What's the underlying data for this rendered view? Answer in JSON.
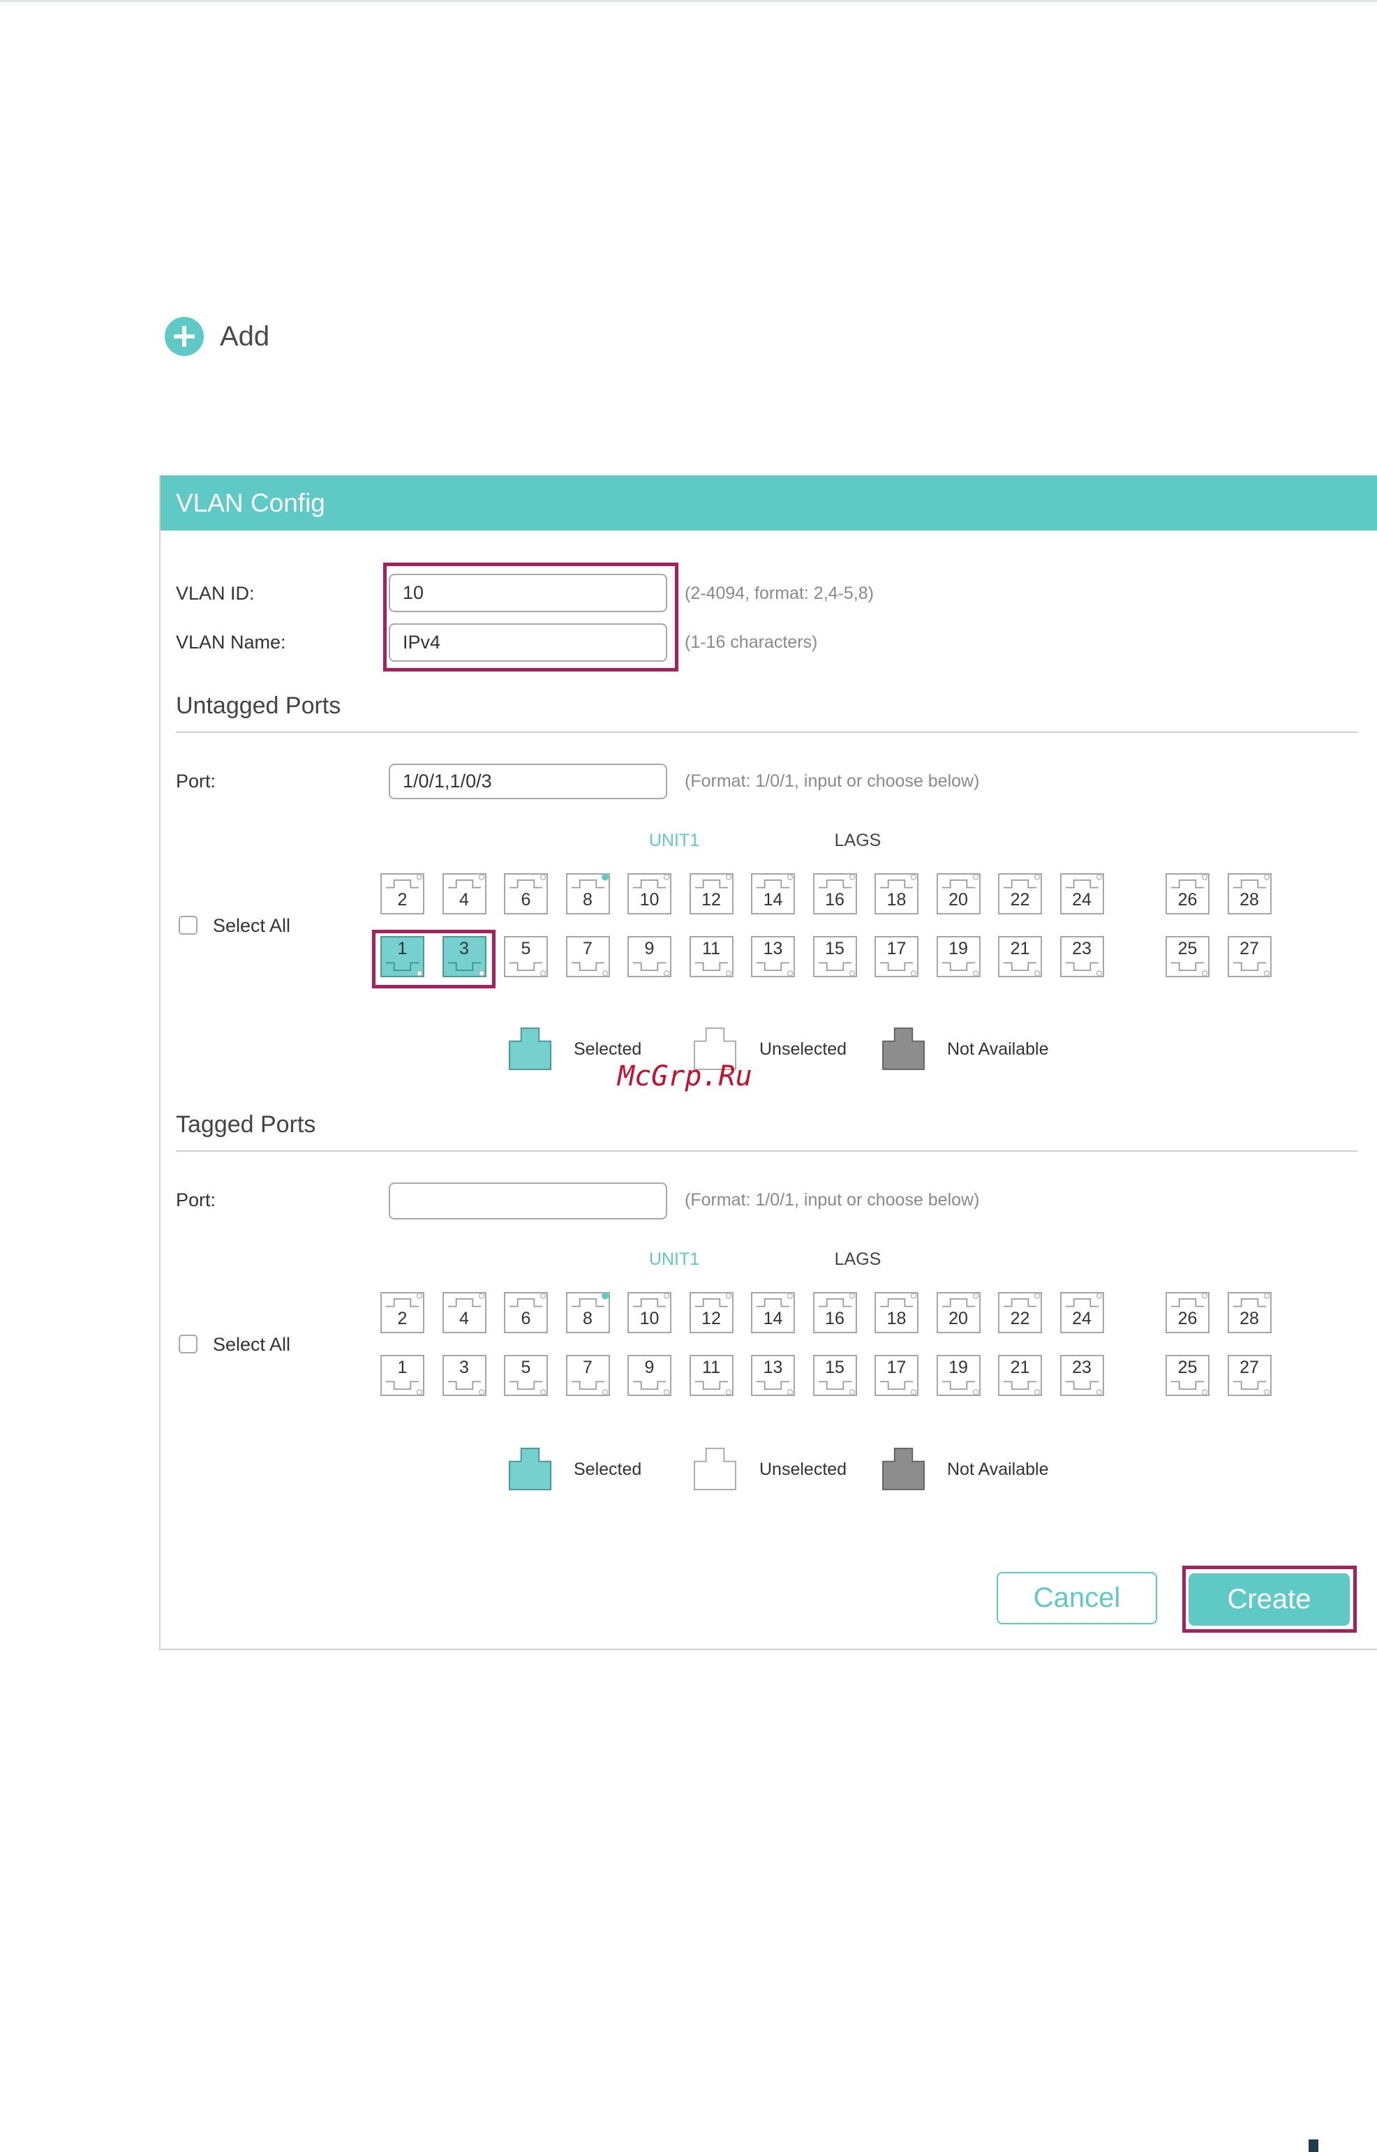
{
  "colors": {
    "accent": "#5fc9c6",
    "highlight": "#a6215e",
    "selected_port": "#76d1ce",
    "selected_port_stroke": "#3f8f8d",
    "not_available": "#8d8d8d",
    "watermark": "#c8102e"
  },
  "toolbar": {
    "add_label": "Add",
    "add_icon": "plus-circle-icon"
  },
  "panel": {
    "title": "VLAN Config",
    "vlan_id": {
      "label": "VLAN ID:",
      "value": "10",
      "hint": "(2-4094, format: 2,4-5,8)"
    },
    "vlan_name": {
      "label": "VLAN Name:",
      "value": "IPv4",
      "hint": "(1-16 characters)"
    },
    "untagged": {
      "heading": "Untagged Ports",
      "port_label": "Port:",
      "port_value": "1/0/1,1/0/3",
      "port_hint": "(Format: 1/0/1, input or choose below)",
      "unit_label": "UNIT1",
      "lags_label": "LAGS",
      "select_all_label": "Select All",
      "select_all_checked": false,
      "unit_ports_top": [
        "2",
        "4",
        "6",
        "8",
        "10",
        "12",
        "14",
        "16",
        "18",
        "20",
        "22",
        "24"
      ],
      "unit_ports_bottom": [
        "1",
        "3",
        "5",
        "7",
        "9",
        "11",
        "13",
        "15",
        "17",
        "19",
        "21",
        "23"
      ],
      "lag_ports_top": [
        "26",
        "28"
      ],
      "lag_ports_bottom": [
        "25",
        "27"
      ],
      "selected_ports": [
        "1",
        "3"
      ],
      "link_up_ports": [
        "8"
      ]
    },
    "tagged": {
      "heading": "Tagged Ports",
      "port_label": "Port:",
      "port_hint": "(Format: 1/0/1, input or choose below)",
      "unit_label": "UNIT1",
      "lags_label": "LAGS",
      "select_all_label": "Select All",
      "select_all_checked": false,
      "unit_ports_top": [
        "2",
        "4",
        "6",
        "8",
        "10",
        "12",
        "14",
        "16",
        "18",
        "20",
        "22",
        "24"
      ],
      "unit_ports_bottom": [
        "1",
        "3",
        "5",
        "7",
        "9",
        "11",
        "13",
        "15",
        "17",
        "19",
        "21",
        "23"
      ],
      "lag_ports_top": [
        "26",
        "28"
      ],
      "lag_ports_bottom": [
        "25",
        "27"
      ],
      "selected_ports": [],
      "link_up_ports": [
        "8"
      ]
    },
    "legend": {
      "selected": "Selected",
      "unselected": "Unselected",
      "not_available": "Not Available"
    },
    "buttons": {
      "cancel": "Cancel",
      "create": "Create"
    }
  },
  "watermark": "McGrp.Ru"
}
